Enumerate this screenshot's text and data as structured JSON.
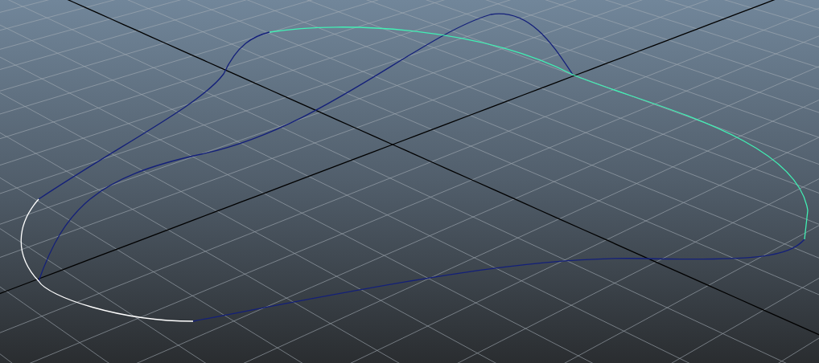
{
  "viewport": {
    "curves": [
      {
        "color": "#14207a"
      },
      {
        "color": "#14207a"
      },
      {
        "color": "#14207a"
      },
      {
        "color": "#41f0b4"
      },
      {
        "color": "#ffffff"
      }
    ]
  }
}
